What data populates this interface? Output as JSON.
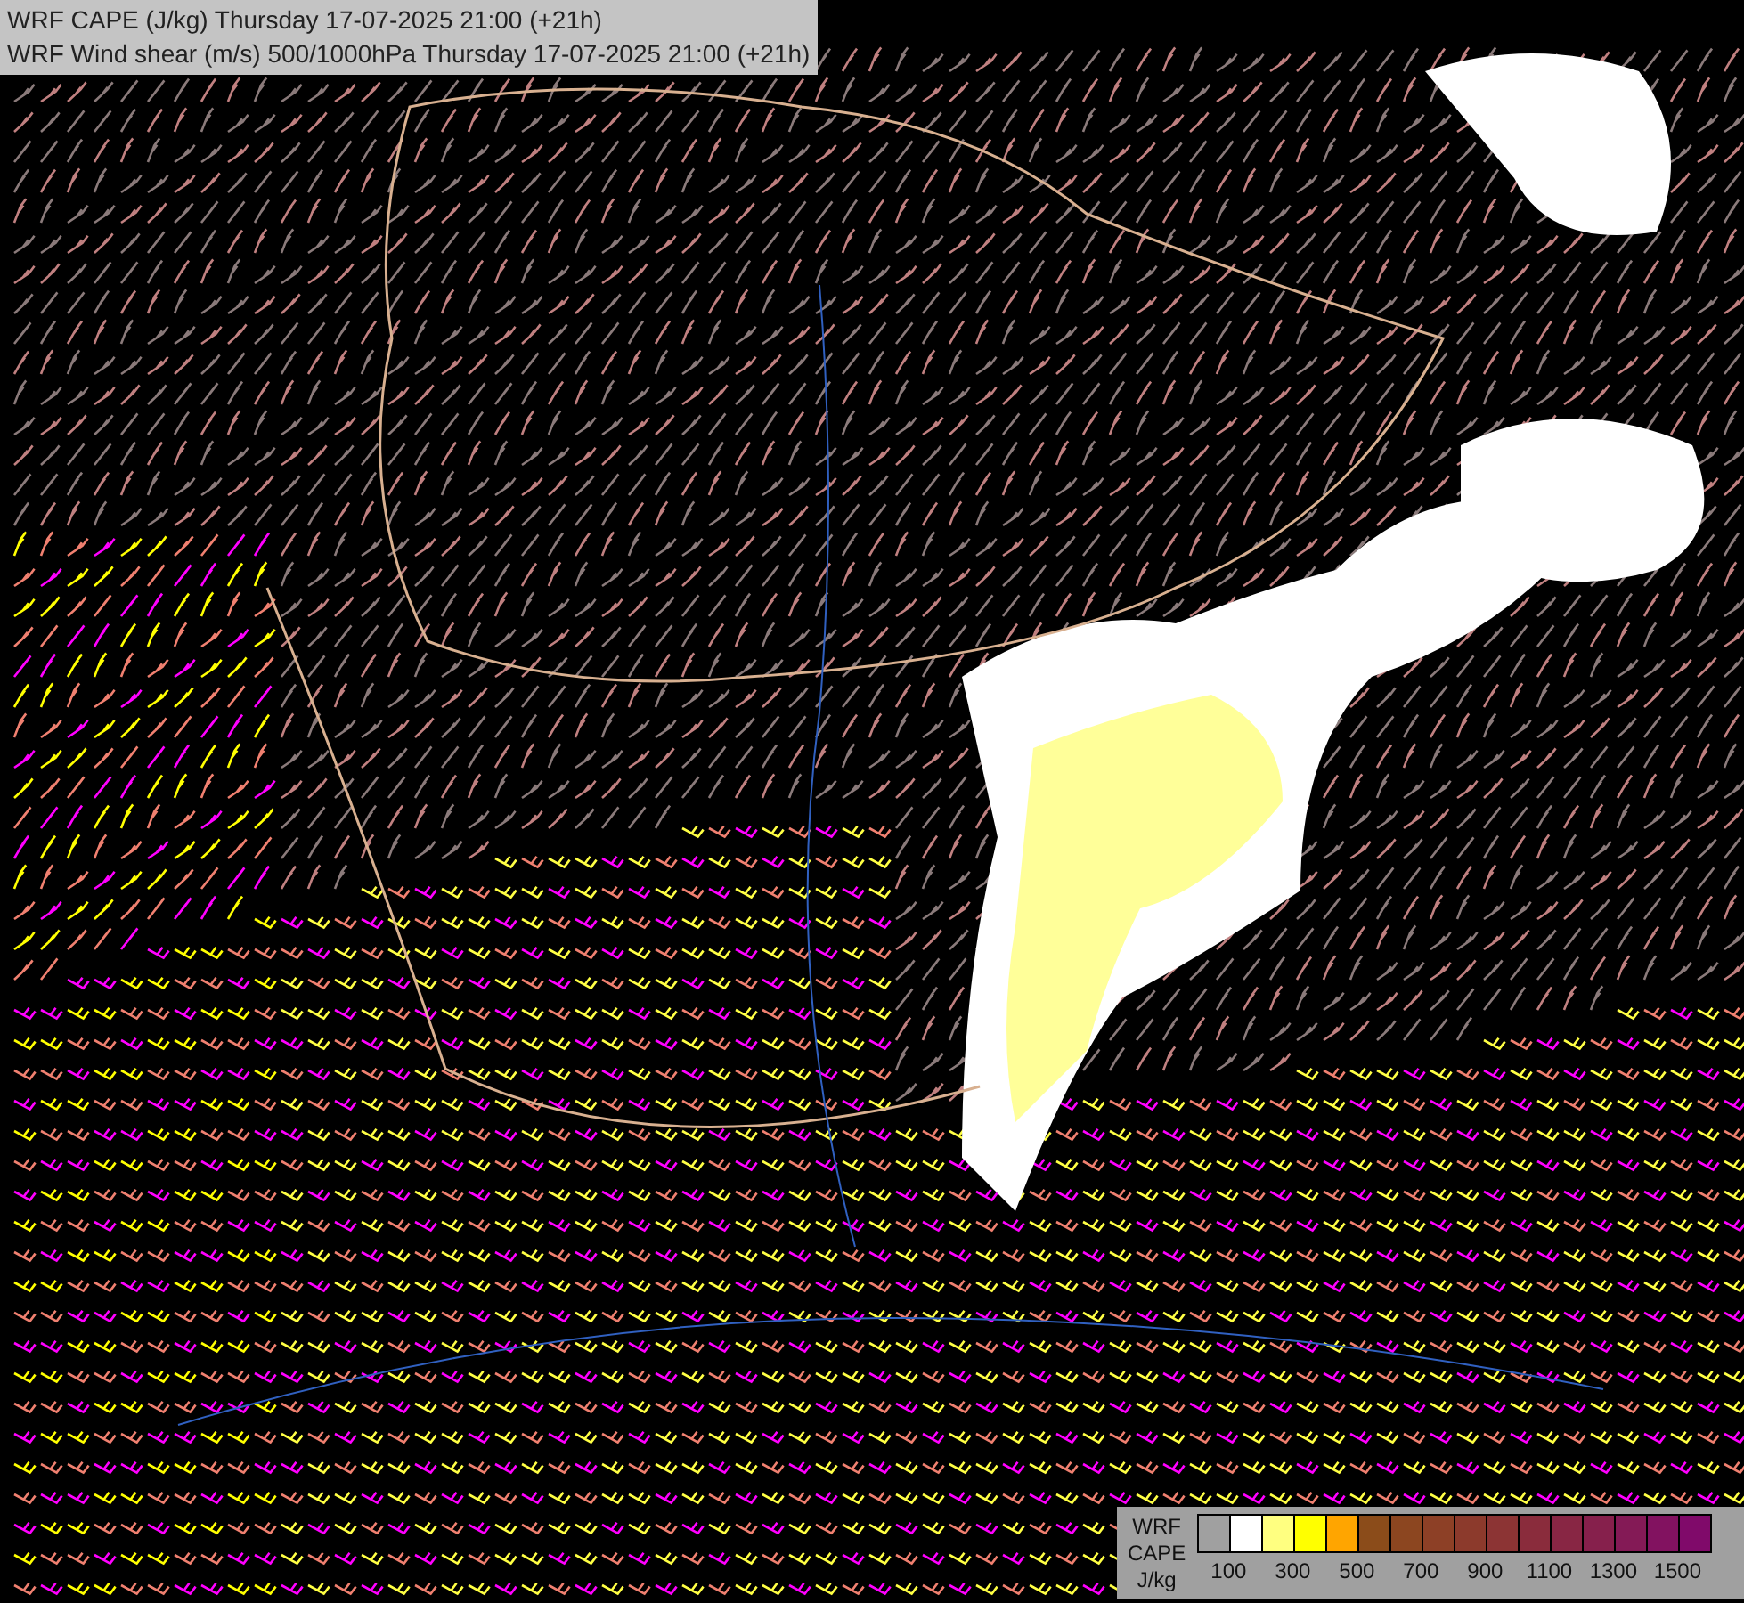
{
  "title_lines": [
    "WRF CAPE (J/kg) Thursday 17-07-2025 21:00 (+21h)",
    "WRF Wind shear (m/s) 500/1000hPa Thursday 17-07-2025 21:00 (+21h)"
  ],
  "legend": {
    "labels": [
      "WRF",
      "CAPE",
      "J/kg"
    ],
    "swatches": [
      {
        "kind": "empty"
      },
      {
        "kind": "fill",
        "color": "#ffffff"
      },
      {
        "kind": "fill",
        "color": "#ffff80"
      },
      {
        "kind": "fill",
        "color": "#ffff00"
      },
      {
        "kind": "fill",
        "color": "#ffa500"
      },
      {
        "kind": "fill",
        "color": "#8b4c1a"
      },
      {
        "kind": "fill",
        "color": "#8c4620"
      },
      {
        "kind": "fill",
        "color": "#8d4026"
      },
      {
        "kind": "fill",
        "color": "#8c3a2c"
      },
      {
        "kind": "fill",
        "color": "#8c3434"
      },
      {
        "kind": "fill",
        "color": "#8a2c3c"
      },
      {
        "kind": "fill",
        "color": "#882644"
      },
      {
        "kind": "fill",
        "color": "#86204c"
      },
      {
        "kind": "fill",
        "color": "#841a56"
      },
      {
        "kind": "fill",
        "color": "#821260"
      },
      {
        "kind": "fill",
        "color": "#800a6a"
      }
    ],
    "ticks": [
      "100",
      "300",
      "500",
      "700",
      "900",
      "1100",
      "1300",
      "1500"
    ]
  }
}
